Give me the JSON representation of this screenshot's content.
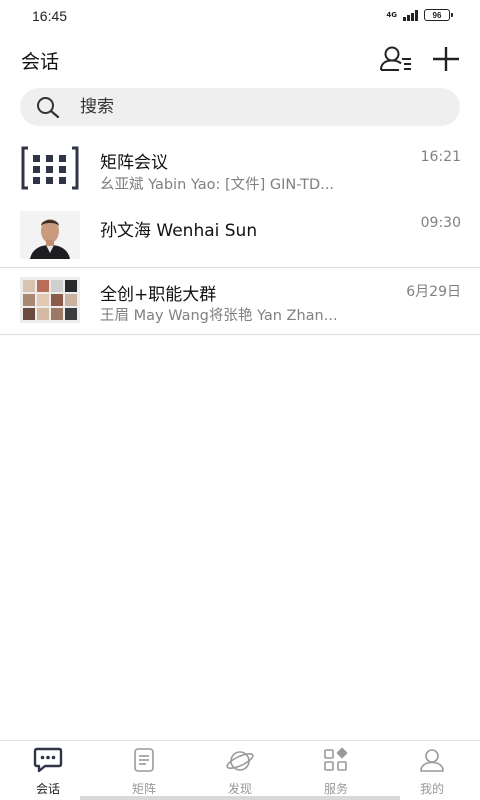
{
  "status_bar": {
    "time": "16:45",
    "network": "4G",
    "battery": "96"
  },
  "header": {
    "title": "会话"
  },
  "search": {
    "placeholder": "搜索"
  },
  "chats": [
    {
      "name": "矩阵会议",
      "preview": "幺亚斌 Yabin Yao: [文件] GIN-TD...",
      "time": "16:21",
      "avatar": "grid-icon"
    },
    {
      "name": "孙文海 Wenhai Sun",
      "preview": "",
      "time": "09:30",
      "avatar": "person-photo"
    },
    {
      "name": "全创+职能大群",
      "preview": "王眉 May Wang将张艳 Yan Zhan...",
      "time": "6月29日",
      "avatar": "group-photo-grid"
    }
  ],
  "bottom_nav": [
    {
      "label": "会话",
      "icon": "chat-bubble-icon",
      "active": true
    },
    {
      "label": "矩阵",
      "icon": "list-icon",
      "active": false
    },
    {
      "label": "发现",
      "icon": "discover-icon",
      "active": false
    },
    {
      "label": "服务",
      "icon": "apps-icon",
      "active": false
    },
    {
      "label": "我的",
      "icon": "profile-icon",
      "active": false
    }
  ]
}
